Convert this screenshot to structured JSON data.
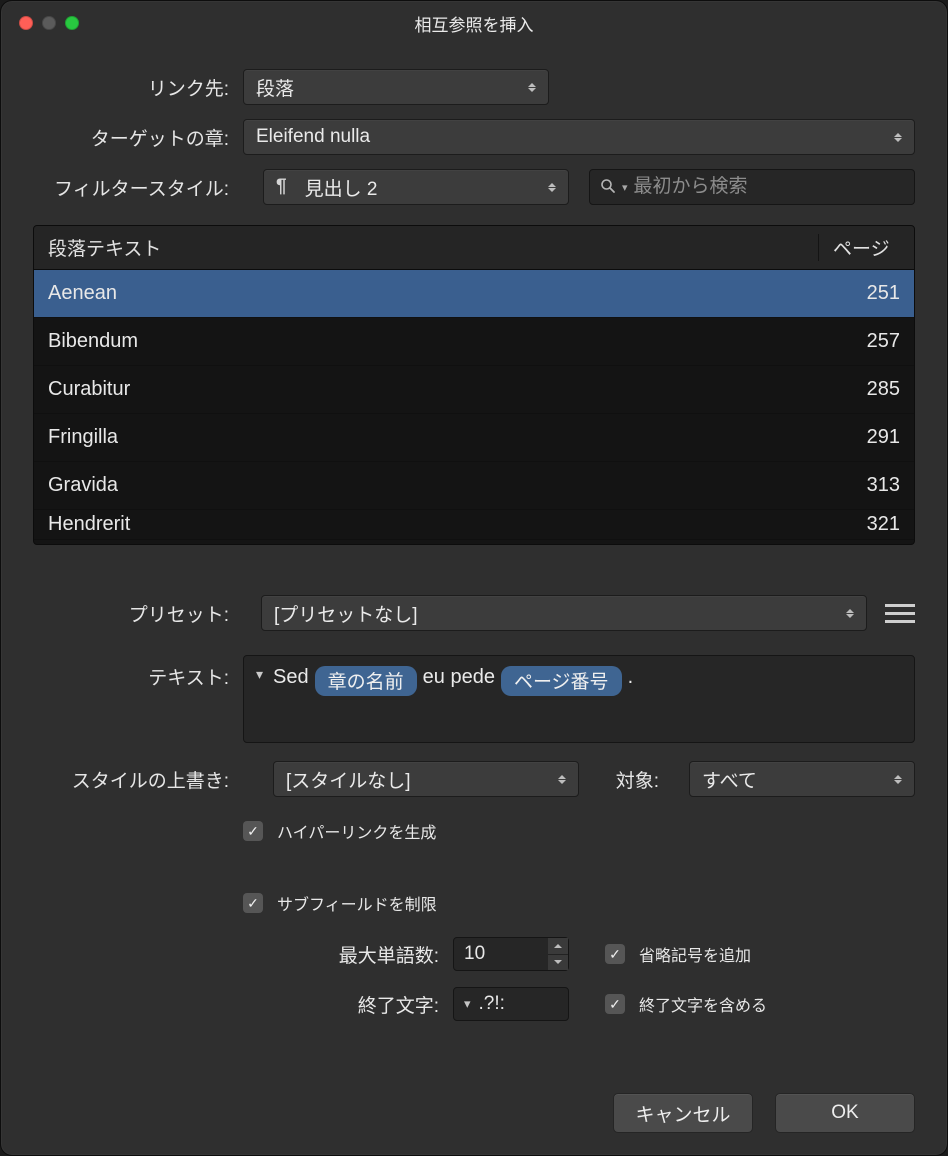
{
  "window": {
    "title": "相互参照を挿入"
  },
  "labels": {
    "link_to": "リンク先:",
    "chapter": "ターゲットの章:",
    "filter_style": "フィルタースタイル:",
    "preset": "プリセット:",
    "text": "テキスト:",
    "style_override": "スタイルの上書き:",
    "for": "対象:",
    "max_words": "最大単語数:",
    "terminators": "終了文字:"
  },
  "values": {
    "link_to": "段落",
    "chapter": "Eleifend nulla",
    "filter_style": "見出し 2",
    "preset": "[プリセットなし]",
    "style_override": "[スタイルなし]",
    "for": "すべて",
    "max_words": "10",
    "terminators": ".?!:"
  },
  "search": {
    "placeholder": "最初から検索"
  },
  "table": {
    "head_text": "段落テキスト",
    "head_page": "ページ",
    "rows": [
      {
        "text": "Aenean",
        "page": "251",
        "selected": true
      },
      {
        "text": "Bibendum",
        "page": "257"
      },
      {
        "text": "Curabitur",
        "page": "285"
      },
      {
        "text": "Fringilla",
        "page": "291"
      },
      {
        "text": "Gravida",
        "page": "313"
      },
      {
        "text": "Hendrerit",
        "page": "321"
      }
    ]
  },
  "text_field": {
    "items": [
      {
        "k": "word",
        "v": "Sed"
      },
      {
        "k": "token",
        "v": "章の名前"
      },
      {
        "k": "word",
        "v": "eu pede"
      },
      {
        "k": "token",
        "v": "ページ番号"
      },
      {
        "k": "word",
        "v": "."
      }
    ]
  },
  "checks": {
    "hyperlink": "ハイパーリンクを生成",
    "limit_sub": "サブフィールドを制限",
    "add_ellipsis": "省略記号を追加",
    "include_term": "終了文字を含める"
  },
  "buttons": {
    "cancel": "キャンセル",
    "ok": "OK"
  }
}
